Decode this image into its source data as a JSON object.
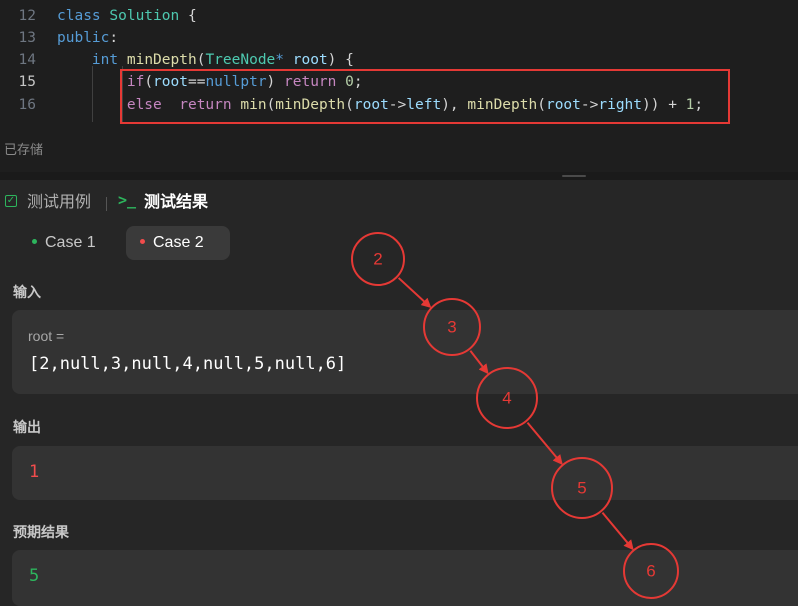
{
  "editor": {
    "lines": [
      {
        "number": "12",
        "tokens": [
          [
            "kw",
            "class"
          ],
          [
            "pl",
            " "
          ],
          [
            "ty",
            "Solution"
          ],
          [
            "pl",
            " {"
          ]
        ]
      },
      {
        "number": "13",
        "tokens": [
          [
            "kw",
            "public"
          ],
          [
            "pl",
            ":"
          ]
        ]
      },
      {
        "number": "14",
        "tokens": [
          [
            "pl",
            "    "
          ],
          [
            "kw",
            "int"
          ],
          [
            "pl",
            " "
          ],
          [
            "fn",
            "minDepth"
          ],
          [
            "pl",
            "("
          ],
          [
            "ty",
            "TreeNode"
          ],
          [
            "kw",
            "*"
          ],
          [
            "pl",
            " "
          ],
          [
            "var",
            "root"
          ],
          [
            "pl",
            ") {"
          ]
        ]
      },
      {
        "number": "15",
        "tokens": [
          [
            "pl",
            "        "
          ],
          [
            "kw2",
            "if"
          ],
          [
            "pl",
            "("
          ],
          [
            "var",
            "root"
          ],
          [
            "pl",
            "=="
          ],
          [
            "kw",
            "nullptr"
          ],
          [
            "pl",
            ") "
          ],
          [
            "kw2",
            "return"
          ],
          [
            "pl",
            " "
          ],
          [
            "num",
            "0"
          ],
          [
            "pl",
            ";"
          ]
        ]
      },
      {
        "number": "16",
        "tokens": [
          [
            "pl",
            "        "
          ],
          [
            "kw2",
            "else"
          ],
          [
            "pl",
            "  "
          ],
          [
            "kw2",
            "return"
          ],
          [
            "pl",
            " "
          ],
          [
            "fn",
            "min"
          ],
          [
            "pl",
            "("
          ],
          [
            "fn",
            "minDepth"
          ],
          [
            "pl",
            "("
          ],
          [
            "var",
            "root"
          ],
          [
            "pl",
            "->"
          ],
          [
            "var",
            "left"
          ],
          [
            "pl",
            "), "
          ],
          [
            "fn",
            "minDepth"
          ],
          [
            "pl",
            "("
          ],
          [
            "var",
            "root"
          ],
          [
            "pl",
            "->"
          ],
          [
            "var",
            "right"
          ],
          [
            "pl",
            ")) + "
          ],
          [
            "num",
            "1"
          ],
          [
            "pl",
            ";"
          ]
        ]
      }
    ],
    "active_line": "15",
    "saved_status": "已存储"
  },
  "tabs": {
    "testcase_label": "测试用例",
    "result_label": "测试结果",
    "terminal_icon": ">_"
  },
  "cases": [
    {
      "label": "Case 1",
      "status": "pass"
    },
    {
      "label": "Case 2",
      "status": "fail",
      "selected": true
    }
  ],
  "input": {
    "section_label": "输入",
    "var_name": "root =",
    "value": "[2,null,3,null,4,null,5,null,6]"
  },
  "output": {
    "section_label": "输出",
    "value": "1"
  },
  "expected": {
    "section_label": "预期结果",
    "value": "5"
  },
  "annotation_tree": {
    "color": "#e53935",
    "nodes": [
      "2",
      "3",
      "4",
      "5",
      "6"
    ]
  },
  "colors": {
    "accent_green": "#2db55d",
    "error_red": "#f14c4c",
    "highlight_box": "#e53935"
  }
}
